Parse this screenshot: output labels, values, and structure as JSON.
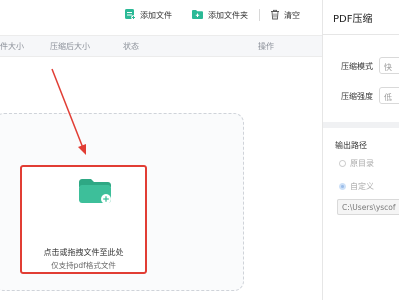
{
  "toolbar": {
    "add_file": "添加文件",
    "add_folder": "添加文件夹",
    "clear": "清空",
    "accent": "#2bb996"
  },
  "table": {
    "columns": [
      "件大小",
      "压缩后大小",
      "状态",
      "操作"
    ]
  },
  "drop_zone": {
    "main_text": "点击或拖拽文件至此处",
    "sub_text": "仅支持pdf格式文件",
    "folder_color": "#3dbf9a",
    "highlight_color": "#e13d34"
  },
  "panel": {
    "title": "PDF压缩",
    "mode_label": "压缩模式",
    "mode_value": "快",
    "strength_label": "压缩强度",
    "strength_value": "低",
    "output_label": "输出路径",
    "option_original": "原目录",
    "option_custom": "自定义",
    "selected_option": "自定义",
    "path_value": "C:\\Users\\yscof"
  }
}
